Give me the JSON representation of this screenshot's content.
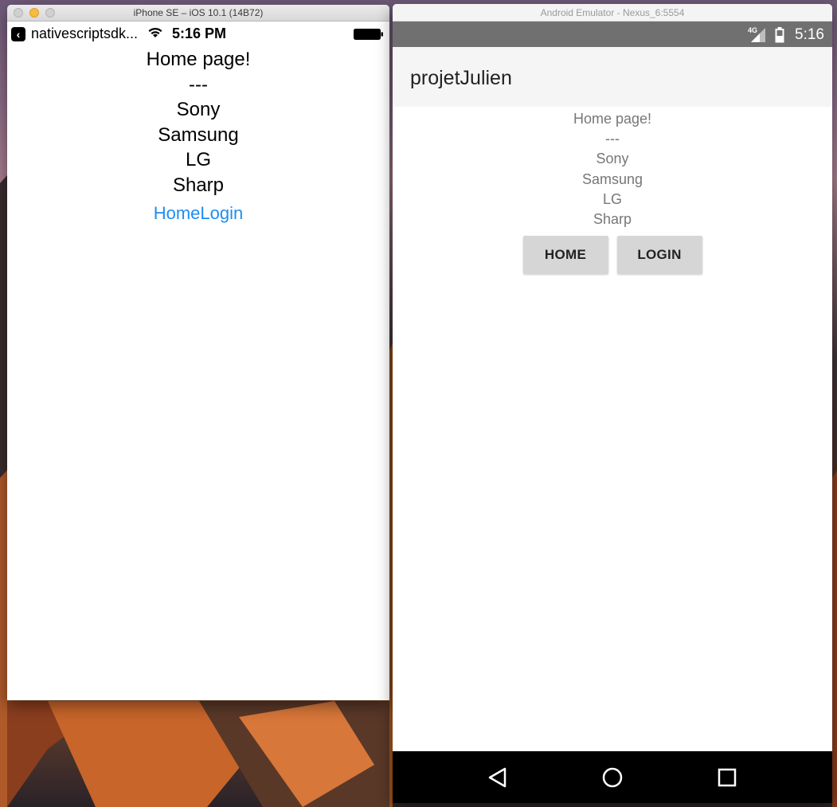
{
  "ios": {
    "window_title": "iPhone SE – iOS 10.1 (14B72)",
    "status": {
      "carrier": "nativescriptsdk...",
      "time": "5:16 PM"
    },
    "lines": [
      "Home page!",
      "---",
      "Sony",
      "Samsung",
      "LG",
      "Sharp"
    ],
    "links": {
      "home": "Home",
      "login": "Login"
    },
    "colors": {
      "link": "#1e8ef0"
    }
  },
  "android": {
    "window_title": "Android Emulator - Nexus_6:5554",
    "status": {
      "network": "4G",
      "time": "5:16"
    },
    "app_title": "projetJulien",
    "lines": [
      "Home page!",
      "---",
      "Sony",
      "Samsung",
      "LG",
      "Sharp"
    ],
    "buttons": {
      "home": "HOME",
      "login": "LOGIN"
    },
    "nav": [
      "back-icon",
      "home-icon",
      "recents-icon"
    ]
  }
}
